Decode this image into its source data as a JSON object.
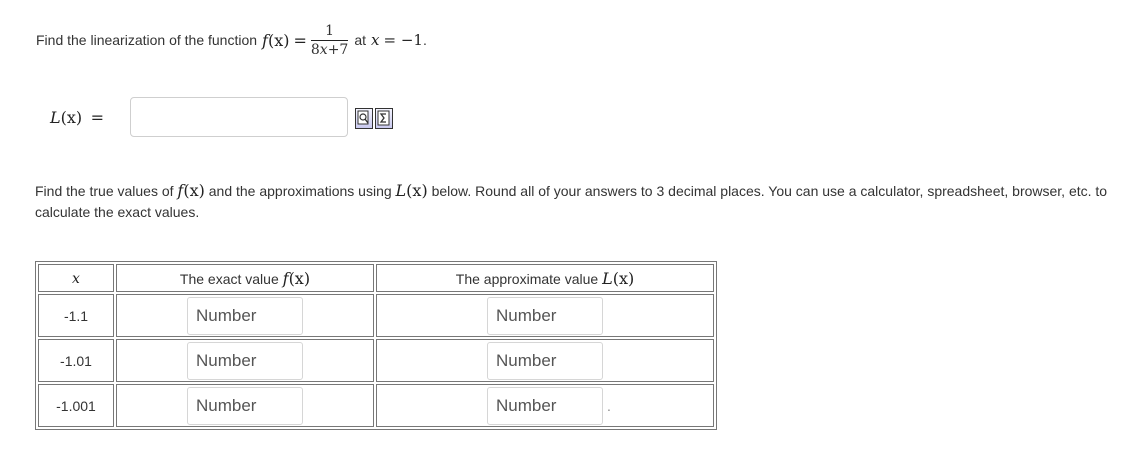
{
  "problem": {
    "prefix": "Find the linearization of the function",
    "func_name": "f",
    "arg": "(x)",
    "equals": "=",
    "fraction": {
      "numerator": "1",
      "denominator_coef": "8",
      "denominator_var": "x",
      "denominator_rest": "+7"
    },
    "at_text": "at",
    "point_var": "x",
    "point_value": "= −1",
    "period": "."
  },
  "linearization": {
    "label_func": "L",
    "label_arg": "(x)",
    "label_eq": "=",
    "input_value": "",
    "input_placeholder": "",
    "icons": [
      "preview-icon",
      "equation-editor-icon"
    ]
  },
  "instructions": {
    "text_before": "Find the true values of",
    "func": "f",
    "func_arg": "(x)",
    "text_middle": "and the approximations using",
    "approx": "L",
    "approx_arg": "(x)",
    "text_after": "below. Round all of your answers to 3 decimal places. You can use a calculator, spreadsheet, browser, etc. to calculate the exact values."
  },
  "table": {
    "headers": {
      "x_var": "x",
      "exact_label": "The exact value",
      "exact_func": "f",
      "exact_arg": "(x)",
      "approx_label": "The approximate value",
      "approx_func": "L",
      "approx_arg": "(x)"
    },
    "rows": [
      {
        "x": "-1.1",
        "exact_placeholder": "Number",
        "approx_placeholder": "Number"
      },
      {
        "x": "-1.01",
        "exact_placeholder": "Number",
        "approx_placeholder": "Number"
      },
      {
        "x": "-1.001",
        "exact_placeholder": "Number",
        "approx_placeholder": "Number"
      }
    ],
    "trailing_dot": "."
  }
}
